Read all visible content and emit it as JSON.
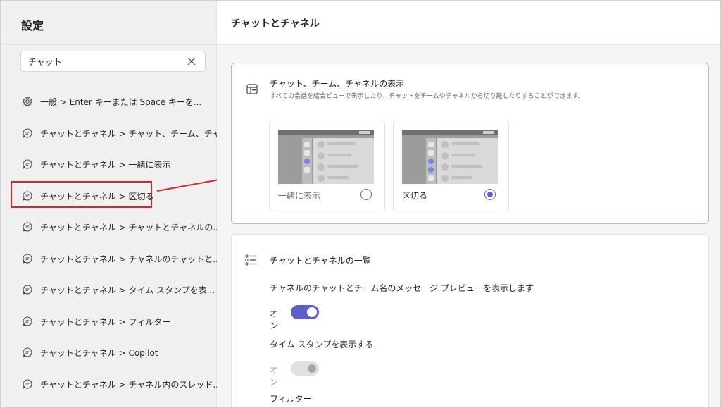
{
  "sidebar": {
    "title": "設定",
    "search": {
      "value": "チャット",
      "placeholder": ""
    },
    "results": [
      {
        "icon": "gear-icon",
        "label": "一般 > Enter キーまたは Space キーを...",
        "highlighted": false
      },
      {
        "icon": "chat-icon",
        "label": "チャットとチャネル > チャット、チーム、チャ...",
        "highlighted": false
      },
      {
        "icon": "chat-icon",
        "label": "チャットとチャネル > 一緒に表示",
        "highlighted": false
      },
      {
        "icon": "chat-icon",
        "label": "チャットとチャネル > 区切る",
        "highlighted": true
      },
      {
        "icon": "chat-icon",
        "label": "チャットとチャネル > チャットとチャネルの...",
        "highlighted": false
      },
      {
        "icon": "chat-icon",
        "label": "チャットとチャネル > チャネルのチャットと...",
        "highlighted": false
      },
      {
        "icon": "chat-icon",
        "label": "チャットとチャネル > タイム スタンプを表...",
        "highlighted": false
      },
      {
        "icon": "chat-icon",
        "label": "チャットとチャネル > フィルター",
        "highlighted": false
      },
      {
        "icon": "chat-icon",
        "label": "チャットとチャネル > Copilot",
        "highlighted": false
      },
      {
        "icon": "chat-icon",
        "label": "チャットとチャネル > チャネル内のスレッド...",
        "highlighted": false
      }
    ]
  },
  "main": {
    "title": "チャットとチャネル",
    "display_card": {
      "icon": "layout-panel-icon",
      "title": "チャット、チーム、チャネルの表示",
      "description": "すべての会話を結合ビューで表示したり、チャットをチームやチャネルから切り離したりすることができます。",
      "options": [
        {
          "label": "一緒に表示",
          "selected": false
        },
        {
          "label": "区切る",
          "selected": true
        }
      ]
    },
    "list_card": {
      "icon": "list-icon",
      "title": "チャットとチャネルの一覧",
      "settings": [
        {
          "label": "チャネルのチャットとチーム名のメッセージ プレビューを表示します",
          "toggle_text": "オン",
          "state": "on",
          "enabled": true
        },
        {
          "label": "タイム スタンプを表示する",
          "toggle_text": "オン",
          "state": "on",
          "enabled": false
        },
        {
          "label": "フィルター"
        }
      ]
    }
  },
  "colors": {
    "accent": "#5b5fc7",
    "highlight_border": "#d9252b",
    "selected_card_border": "#e8a892"
  }
}
